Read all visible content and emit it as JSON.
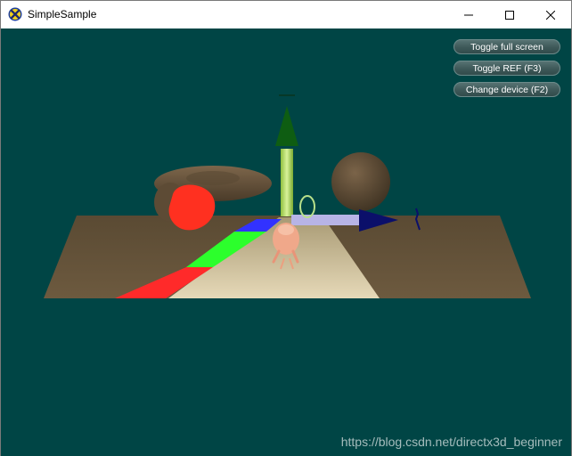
{
  "window": {
    "title": "SimpleSample",
    "icon": "directx-app-icon",
    "controls": [
      "minimize-icon",
      "maximize-icon",
      "close-icon"
    ]
  },
  "viewport": {
    "background": "#004545",
    "buttons": [
      {
        "label": "Toggle full screen"
      },
      {
        "label": "Toggle REF (F3)"
      },
      {
        "label": "Change device (F2)"
      }
    ],
    "watermark": "https://blog.csdn.net/directx3d_beginner"
  },
  "colors": {
    "x_axis": "#0b0f6a",
    "y_axis": "#0e5d12",
    "stripe_red": "#ff2a2a",
    "stripe_green": "#2cff2c",
    "stripe_blue": "#3232ff",
    "sphere_red": "#ff3020"
  }
}
